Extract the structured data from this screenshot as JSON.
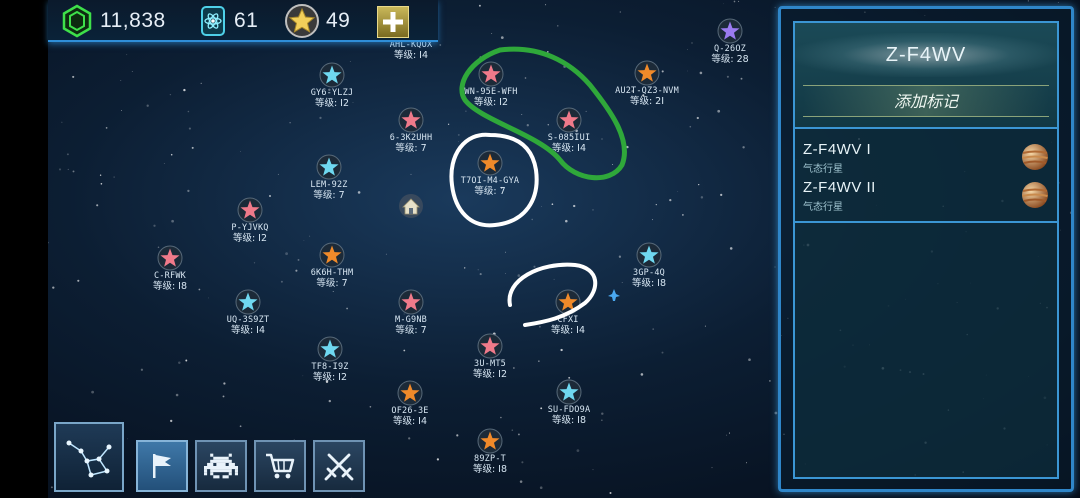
{
  "resources": {
    "credits": "11,838",
    "energy": "61",
    "stars": "49",
    "credits_icon": "cube-hex-icon",
    "energy_icon": "atom-canister-icon",
    "stars_icon": "gold-star-icon",
    "add_icon": "plus-icon"
  },
  "systems": [
    {
      "code": "AHL-KQOX",
      "level": "等级: I4",
      "color": "#6fd8f0"
    },
    {
      "code": "Q-26OZ",
      "level": "等级: 28",
      "color": "#9b7bf0"
    },
    {
      "code": "GY6-YLZJ",
      "level": "等级: I2",
      "color": "#6fd8f0"
    },
    {
      "code": "WN-95E-WFH",
      "level": "等级: I2",
      "color": "#f07a8a"
    },
    {
      "code": "AU2T-QZ3-NVM",
      "level": "等级: 2I",
      "color": "#f08a2a"
    },
    {
      "code": "6-3K2UHH",
      "level": "等级: 7",
      "color": "#f07a8a"
    },
    {
      "code": "S-085IUI",
      "level": "等级: I4",
      "color": "#f07a8a"
    },
    {
      "code": "T7OI-M4-GYA",
      "level": "等级: 7",
      "color": "#f08a2a"
    },
    {
      "code": "LEM-92Z",
      "level": "等级: 7",
      "color": "#6fd8f0"
    },
    {
      "code": "P-YJVKQ",
      "level": "等级: I2",
      "color": "#f07a8a"
    },
    {
      "code": "C-RFWK",
      "level": "等级: I8",
      "color": "#f07a8a"
    },
    {
      "code": "6K6H-THM",
      "level": "等级: 7",
      "color": "#f08a2a"
    },
    {
      "code": "3GP-4Q",
      "level": "等级: I8",
      "color": "#6fd8f0"
    },
    {
      "code": "UQ-3S9ZT",
      "level": "等级: I4",
      "color": "#6fd8f0"
    },
    {
      "code": "M-G9NB",
      "level": "等级: 7",
      "color": "#f07a8a"
    },
    {
      "code": "CFXI",
      "level": "等级: I4",
      "color": "#f08a2a"
    },
    {
      "code": "TF8-I9Z",
      "level": "等级: I2",
      "color": "#6fd8f0"
    },
    {
      "code": "3U-MT5",
      "level": "等级: I2",
      "color": "#f07a8a"
    },
    {
      "code": "OF26-3E",
      "level": "等级: I4",
      "color": "#f08a2a"
    },
    {
      "code": "SU-FDO9A",
      "level": "等级: I8",
      "color": "#6fd8f0"
    },
    {
      "code": "89ZP-T",
      "level": "等级: I8",
      "color": "#f08a2a"
    }
  ],
  "panel": {
    "title": "Z-F4WV",
    "add_marker": "添加标记",
    "planets": [
      {
        "name": "Z-F4WV I",
        "type": "气态行星",
        "icon": "gas-giant-icon"
      },
      {
        "name": "Z-F4WV II",
        "type": "气态行星",
        "icon": "gas-giant-icon"
      }
    ]
  },
  "toolbar": {
    "constellation_icon": "constellation-icon",
    "flag_icon": "flag-icon",
    "invader_icon": "space-invader-icon",
    "cart_icon": "shopping-cart-icon",
    "swords_icon": "crossed-swords-icon"
  },
  "map_icons": {
    "home": "home-base-icon",
    "ship": "ship-icon"
  },
  "annotation_colors": {
    "green_loop": "#2fa83a",
    "white_marks": "#ffffff"
  }
}
